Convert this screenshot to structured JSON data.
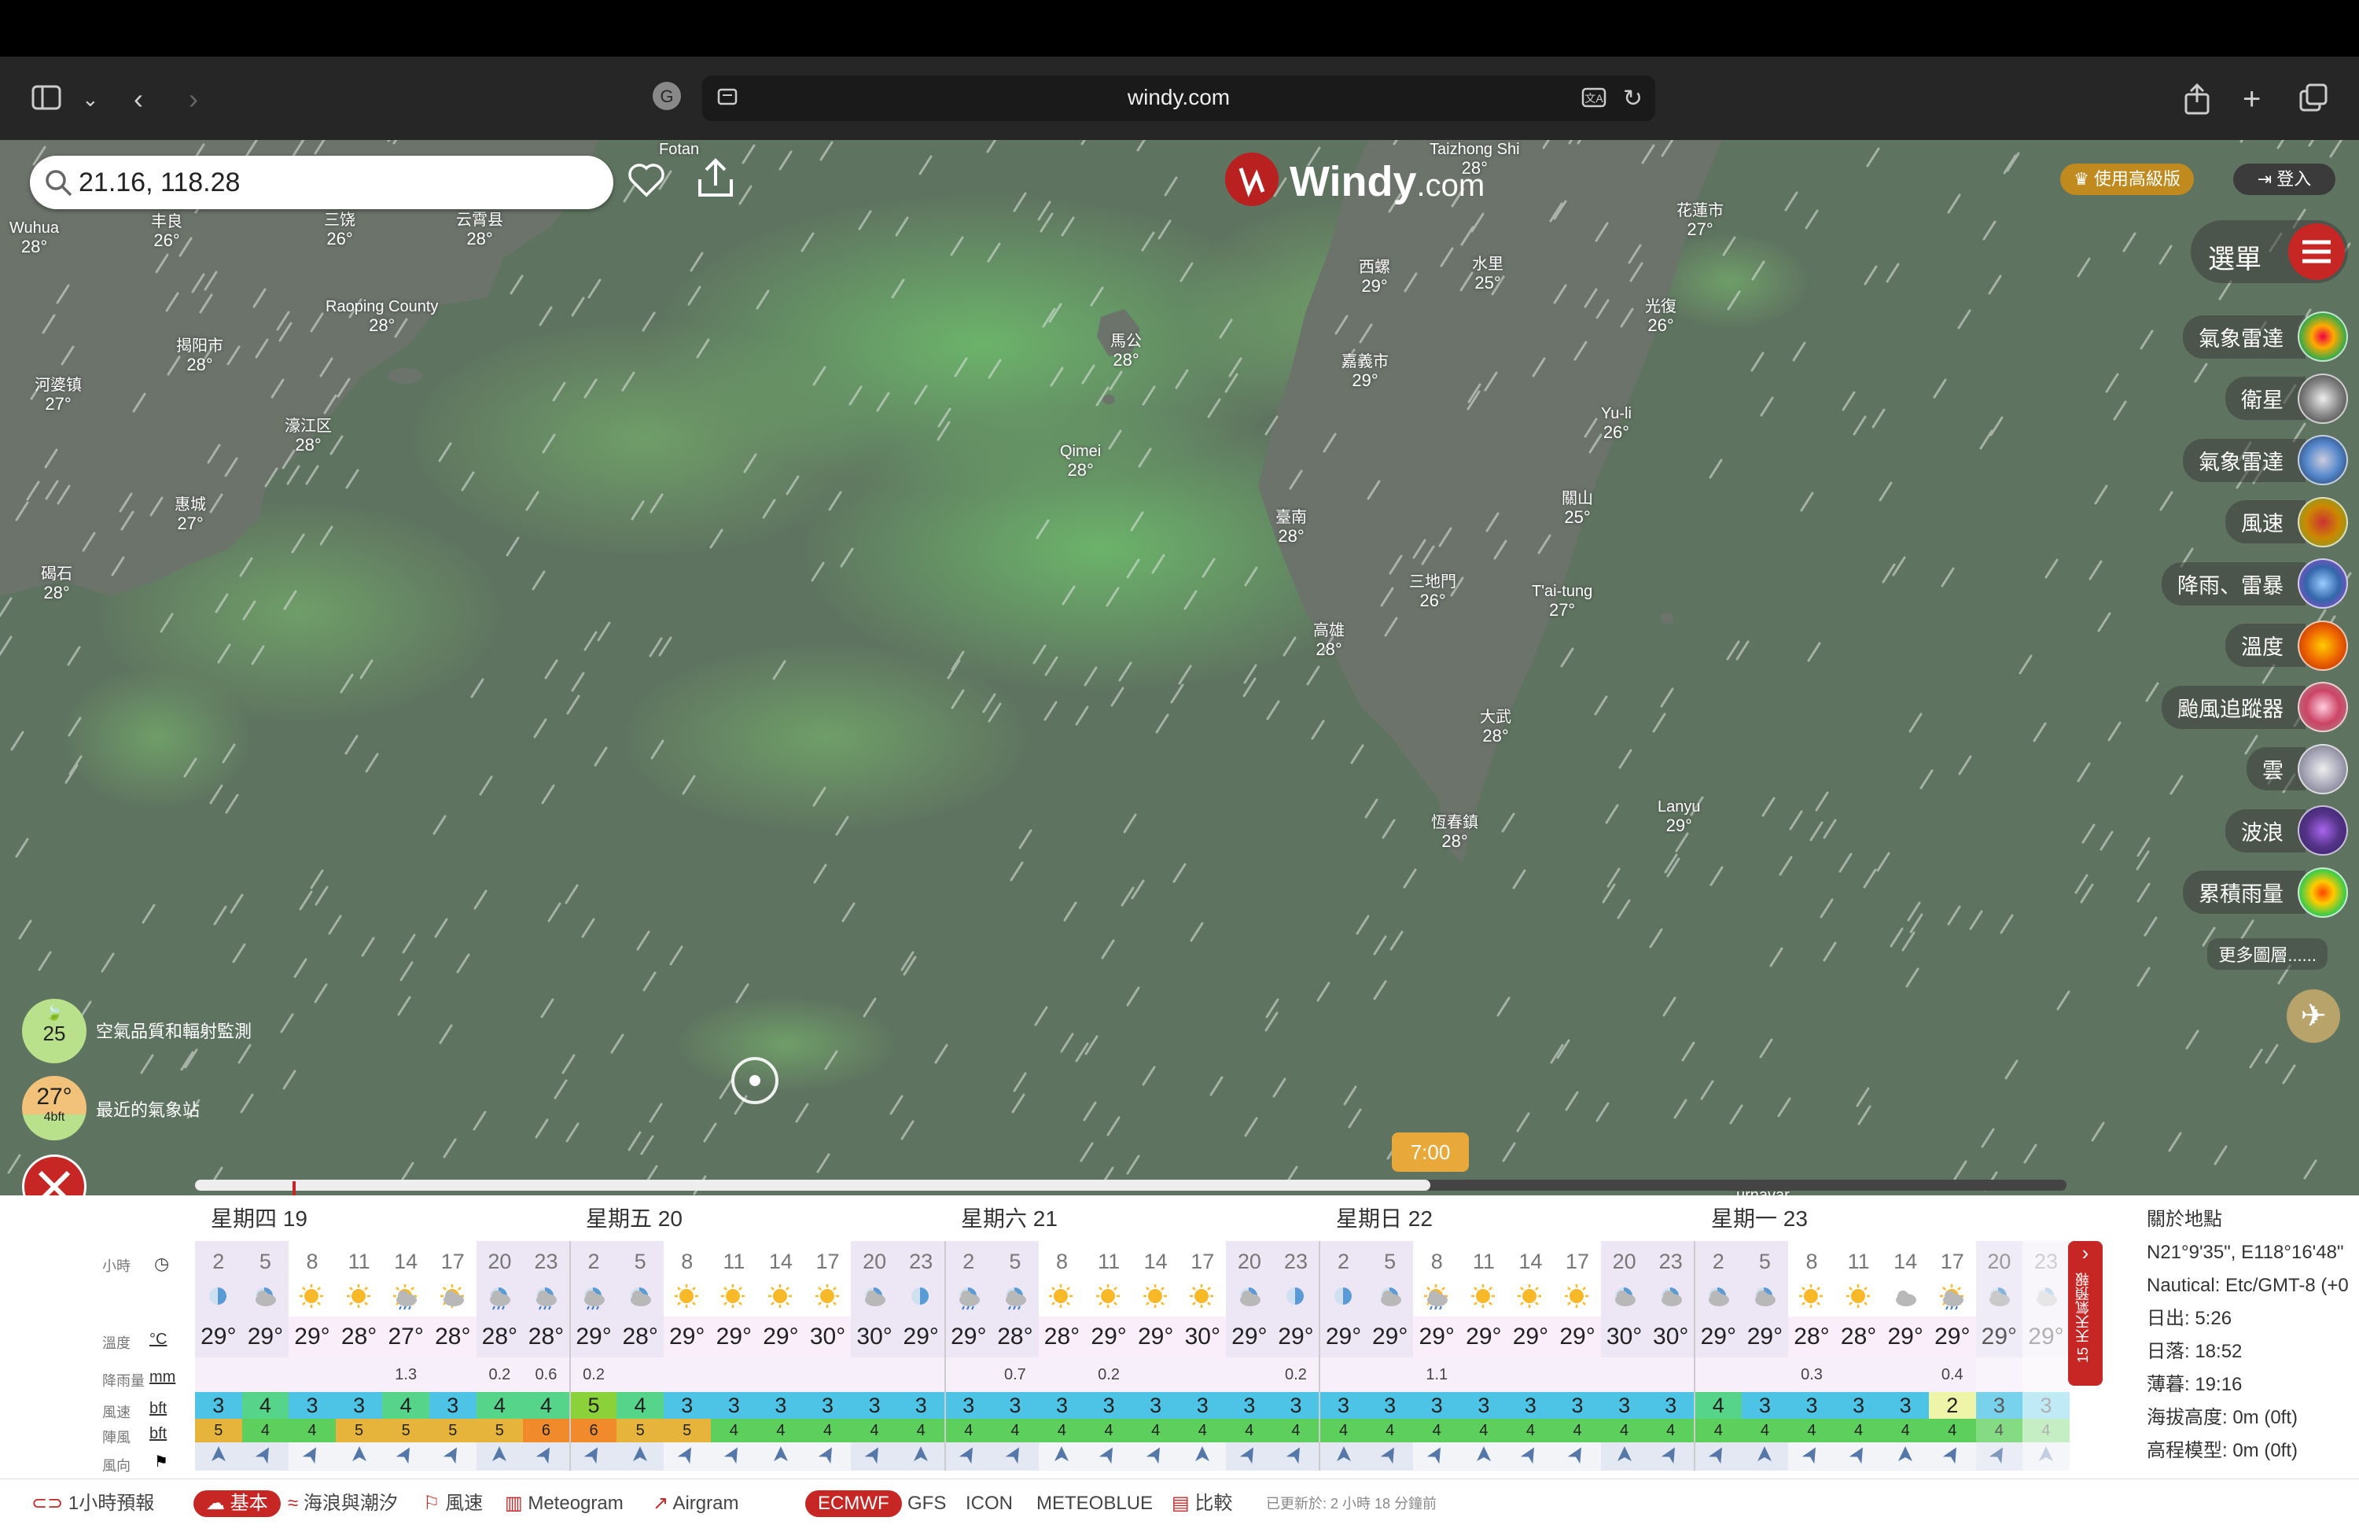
{
  "browser": {
    "url": "windy.com"
  },
  "search": {
    "value": "21.16, 118.28"
  },
  "logo": {
    "text": "Windy",
    "suffix": ".com"
  },
  "header": {
    "premium": "使用高級版",
    "login": "登入"
  },
  "menu": {
    "label": "選單"
  },
  "layers": [
    "氣象雷達",
    "衛星",
    "氣象雷達",
    "風速",
    "降雨、雷暴",
    "溫度",
    "颱風追蹤器",
    "雲",
    "波浪",
    "累積雨量"
  ],
  "more_layers": "更多圖層......",
  "cities": [
    {
      "name": "Fotan",
      "temp": ""
    },
    {
      "name": "Taizhong Shi",
      "temp": "28°"
    },
    {
      "name": "Wuhua",
      "temp": "28°"
    },
    {
      "name": "丰良",
      "temp": "26°"
    },
    {
      "name": "三饶",
      "temp": "26°"
    },
    {
      "name": "云霄县",
      "temp": "28°"
    },
    {
      "name": "Raoping County",
      "temp": "28°"
    },
    {
      "name": "揭阳市",
      "temp": "28°"
    },
    {
      "name": "河婆镇",
      "temp": "27°"
    },
    {
      "name": "濠江区",
      "temp": "28°"
    },
    {
      "name": "惠城",
      "temp": "27°"
    },
    {
      "name": "碣石",
      "temp": "28°"
    },
    {
      "name": "馬公",
      "temp": "28°"
    },
    {
      "name": "Qimei",
      "temp": "28°"
    },
    {
      "name": "西螺",
      "temp": "29°"
    },
    {
      "name": "水里",
      "temp": "25°"
    },
    {
      "name": "花蓮市",
      "temp": "27°"
    },
    {
      "name": "光復",
      "temp": "26°"
    },
    {
      "name": "嘉義市",
      "temp": "29°"
    },
    {
      "name": "Yu-li",
      "temp": "26°"
    },
    {
      "name": "關山",
      "temp": "25°"
    },
    {
      "name": "臺南",
      "temp": "28°"
    },
    {
      "name": "三地門",
      "temp": "26°"
    },
    {
      "name": "T'ai-tung",
      "temp": "27°"
    },
    {
      "name": "高雄",
      "temp": "28°"
    },
    {
      "name": "大武",
      "temp": "28°"
    },
    {
      "name": "恆春鎮",
      "temp": "28°"
    },
    {
      "name": "Lanyu",
      "temp": "29°"
    },
    {
      "name": "urnavar",
      "temp": ""
    }
  ],
  "widgets": {
    "air_quality_value": "25",
    "air_quality_label": "空氣品質和輻射監測",
    "station_temp": "27°",
    "station_wind": "4bft",
    "station_label": "最近的氣象站"
  },
  "timeline": {
    "current": "7:00",
    "progress": 0.66
  },
  "days": [
    "星期四 19",
    "星期五 20",
    "星期六 21",
    "星期日 22",
    "星期一 23"
  ],
  "row_labels": {
    "hours": "小時",
    "temp": "溫度",
    "temp_unit": "°C",
    "rain": "降雨量",
    "rain_unit": "mm",
    "wind": "風速",
    "wind_unit": "bft",
    "gust": "陣風",
    "gust_unit": "bft",
    "dir": "風向"
  },
  "hours": [
    "2",
    "5",
    "8",
    "11",
    "14",
    "17",
    "20",
    "23",
    "2",
    "5",
    "8",
    "11",
    "14",
    "17",
    "20",
    "23",
    "2",
    "5",
    "8",
    "11",
    "14",
    "17",
    "20",
    "23",
    "2",
    "5",
    "8",
    "11",
    "14",
    "17",
    "20",
    "23",
    "2",
    "5",
    "8",
    "11",
    "14",
    "17",
    "20",
    "23"
  ],
  "weather": [
    "moon",
    "moon-cloud",
    "sun",
    "sun",
    "sun-rain",
    "sun-cloud",
    "moon-rain",
    "moon-rain",
    "moon-rain",
    "moon-cloud",
    "sun",
    "sun",
    "sun",
    "sun",
    "moon-cloud",
    "moon",
    "moon-rain",
    "moon-rain",
    "sun",
    "sun",
    "sun",
    "sun",
    "moon-cloud",
    "moon",
    "moon",
    "moon-cloud",
    "sun-rain",
    "sun",
    "sun",
    "sun",
    "moon-cloud",
    "moon-cloud",
    "moon-cloud",
    "moon-cloud",
    "sun",
    "sun",
    "cloud",
    "sun-rain",
    "moon-cloud",
    "moon-cloud"
  ],
  "temps": [
    "29°",
    "29°",
    "29°",
    "28°",
    "27°",
    "28°",
    "28°",
    "28°",
    "29°",
    "28°",
    "29°",
    "29°",
    "29°",
    "30°",
    "30°",
    "29°",
    "29°",
    "28°",
    "28°",
    "29°",
    "29°",
    "30°",
    "29°",
    "29°",
    "29°",
    "29°",
    "29°",
    "29°",
    "29°",
    "29°",
    "30°",
    "30°",
    "29°",
    "29°",
    "28°",
    "28°",
    "29°",
    "29°",
    "29°",
    "29°"
  ],
  "rain": [
    "",
    "",
    "",
    "",
    "1.3",
    "",
    "0.2",
    "0.6",
    "0.2",
    "",
    "",
    "",
    "",
    "",
    "",
    "",
    "",
    "0.7",
    "",
    "0.2",
    "",
    "",
    "",
    "0.2",
    "",
    "",
    "1.1",
    "",
    "",
    "",
    "",
    "",
    "",
    "",
    "0.3",
    "",
    "",
    "0.4",
    "",
    ""
  ],
  "wind": [
    "3",
    "4",
    "3",
    "3",
    "4",
    "3",
    "4",
    "4",
    "5",
    "4",
    "3",
    "3",
    "3",
    "3",
    "3",
    "3",
    "3",
    "3",
    "3",
    "3",
    "3",
    "3",
    "3",
    "3",
    "3",
    "3",
    "3",
    "3",
    "3",
    "3",
    "3",
    "3",
    "4",
    "3",
    "3",
    "3",
    "3",
    "2",
    "3",
    "3"
  ],
  "gust": [
    "5",
    "4",
    "4",
    "5",
    "5",
    "5",
    "5",
    "6",
    "6",
    "5",
    "5",
    "4",
    "4",
    "4",
    "4",
    "4",
    "4",
    "4",
    "4",
    "4",
    "4",
    "4",
    "4",
    "4",
    "4",
    "4",
    "4",
    "4",
    "4",
    "4",
    "4",
    "4",
    "4",
    "4",
    "4",
    "4",
    "4",
    "4",
    "4",
    "4"
  ],
  "info": {
    "title": "關於地點",
    "coords": "N21°9'35\", E118°16'48\"",
    "tz": "Nautical: Etc/GMT-8 (+0",
    "sunrise": "日出: 5:26",
    "sunset": "日落: 18:52",
    "dusk": "薄暮: 19:16",
    "elevation": "海拔高度: 0m (0ft)",
    "model_elev": "高程模型: 0m (0ft)"
  },
  "side_tab": "15 天天氣預報",
  "tabs": {
    "hourly": "1小時預報",
    "basic": "基本",
    "waves": "海浪與潮汐",
    "wind": "風速",
    "meteogram": "Meteogram",
    "airgram": "Airgram",
    "ecmwf": "ECMWF",
    "gfs": "GFS",
    "icon": "ICON",
    "meteoblue": "METEOBLUE",
    "compare": "比較",
    "updated": "已更新於: 2 小時 18 分鐘前"
  },
  "colors": {
    "accent": "#c72724",
    "map": "#5f7460",
    "land": "#6a736a",
    "premium": "#c08a1e"
  }
}
